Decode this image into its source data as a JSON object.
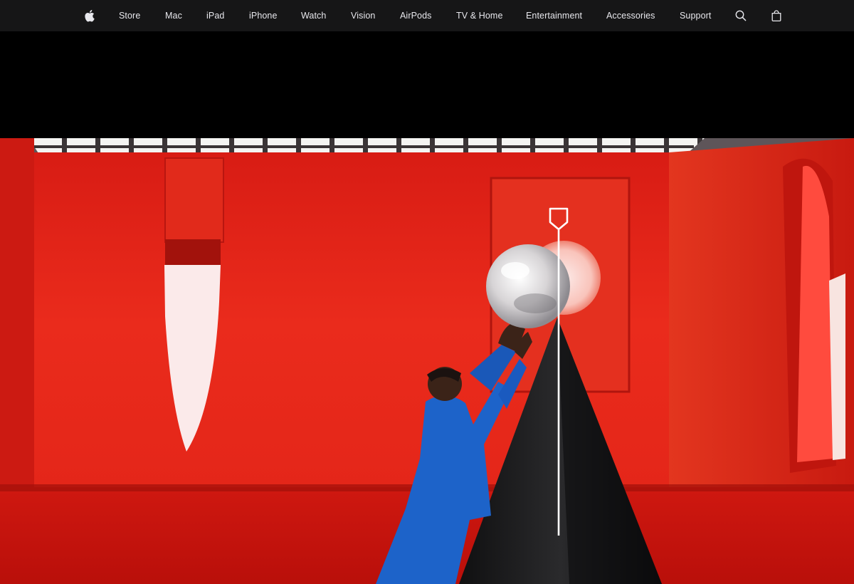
{
  "nav": {
    "logo_icon": "apple-logo-icon",
    "items": [
      "Store",
      "Mac",
      "iPad",
      "iPhone",
      "Watch",
      "Vision",
      "AirPods",
      "TV & Home",
      "Entertainment",
      "Accessories",
      "Support"
    ],
    "search_icon": "search-icon",
    "bag_icon": "shopping-bag-icon",
    "background": "#161617",
    "text_color": "#e8e8ed"
  },
  "hero": {
    "image": "hero-video-frame",
    "overlay_icon": "scroll-pin-indicator-icon",
    "colors": {
      "wall": "#e8241a",
      "floor": "#c9140f",
      "suit": "#1d63c9",
      "pyramid": "#1b1b1d"
    }
  }
}
